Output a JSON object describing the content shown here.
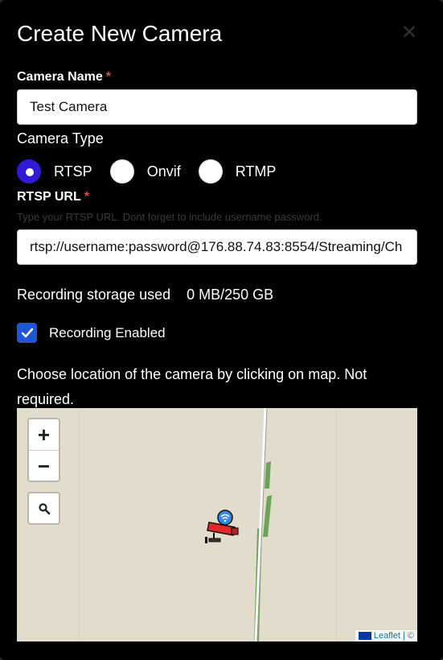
{
  "modal": {
    "title": "Create New Camera",
    "close_icon": "close-icon"
  },
  "form": {
    "camera_name_label": "Camera Name",
    "required_mark": "*",
    "camera_name_value": "Test Camera",
    "camera_type_label": "Camera Type",
    "camera_types": [
      {
        "label": "RTSP",
        "checked": true
      },
      {
        "label": "Onvif",
        "checked": false
      },
      {
        "label": "RTMP",
        "checked": false
      }
    ],
    "rtsp_url_label": "RTSP URL",
    "rtsp_url_hint": "Type your RTSP URL. Dont forget to include username password.",
    "rtsp_url_value": "rtsp://username:password@176.88.74.83:8554/Streaming/Ch",
    "storage_label": "Recording storage used",
    "storage_value": "0 MB/250 GB",
    "recording_enabled_label": "Recording Enabled",
    "recording_enabled": true,
    "map_description": "Choose location of the camera by clicking on map. Not required."
  },
  "map": {
    "zoom_in": "+",
    "zoom_out": "−",
    "search_icon": "search-icon",
    "marker_icon": "camera-marker-icon",
    "attribution": "Leaflet | ©"
  },
  "colors": {
    "background": "#000000",
    "radio_accent": "#2f1bd6",
    "checkbox_accent": "#1f56d6",
    "required": "#e5484d",
    "map_land": "#e2dccd",
    "map_road": "#ffffff",
    "map_green": "#6aa557"
  }
}
